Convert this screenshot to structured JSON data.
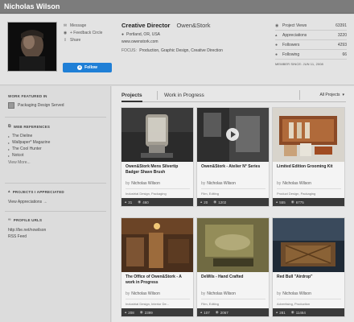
{
  "header": {
    "name": "Nicholas Wilson"
  },
  "profile": {
    "actions": [
      {
        "icon": "envelope-icon",
        "label": "Message"
      },
      {
        "icon": "circle-plus-icon",
        "label": "+ Feedback Circle"
      },
      {
        "icon": "share-icon",
        "label": "Share"
      }
    ],
    "follow_label": "Follow",
    "occupation": "Creative Director",
    "company": "Owen&Stork",
    "location": "Portland, OR, USA",
    "website": "www.owenstork.com",
    "focus_label": "FOCUS:",
    "focus_value": "Production, Graphic Design, Creative Direction"
  },
  "stats": [
    {
      "icon": "eye-icon",
      "label": "Project Views",
      "value": "63391"
    },
    {
      "icon": "thumbs-up-icon",
      "label": "Appreciations",
      "value": "3220"
    },
    {
      "icon": "user-icon",
      "label": "Followers",
      "value": "4293"
    },
    {
      "icon": "user-check-icon",
      "label": "Following",
      "value": "66"
    }
  ],
  "member_since": "MEMBER SINCE: JUN 11, 2008",
  "sidebar": {
    "featured_heading": "WORK FEATURED IN",
    "featured_item": "Packaging Design Served",
    "refs_heading": "WEB REFERENCES",
    "refs": [
      "The Dieline",
      "Wallpaper* Magazine",
      "The Cool Hunter",
      "Notcot"
    ],
    "refs_more": "View More...",
    "appreciated_heading": "PROJECTS I APPRECIATED",
    "appreciated_link": "View Appreciations →",
    "urls_heading": "PROFILE URLS",
    "urls": [
      "http://be.net/nowilson",
      "RSS Feed"
    ]
  },
  "tabs": {
    "projects": "Projects",
    "wip": "Work in Progress",
    "filter": "All Projects"
  },
  "projects": [
    {
      "title": "Owen&Stork Mens Silvertip Badger Shave Brush",
      "owner": "Nicholas Wilson",
      "fields": "Industrial Design, Packaging",
      "appreciations": "31",
      "views": "460"
    },
    {
      "title": "Owen&Stork - Atelier N° Series",
      "owner": "Nicholas Wilson",
      "fields": "Film, Editing",
      "appreciations": "20",
      "views": "1202"
    },
    {
      "title": "Limited Edition Grooming Kit",
      "owner": "Nicholas Wilson",
      "fields": "Product Design, Packaging",
      "appreciations": "555",
      "views": "6775"
    },
    {
      "title": "The Office of Owen&Stork - A work in Progress",
      "owner": "Nicholas Wilson",
      "fields": "Industrial Design, Interior De...",
      "appreciations": "208",
      "views": "2399"
    },
    {
      "title": "DeWils - Hand Crafted",
      "owner": "Nicholas Wilson",
      "fields": "Film, Editing",
      "appreciations": "107",
      "views": "2067"
    },
    {
      "title": "Red Bull \"Airdrop\"",
      "owner": "Nicholas Wilson",
      "fields": "Advertising, Production",
      "appreciations": "281",
      "views": "11464"
    }
  ],
  "labels": {
    "by": "by"
  }
}
